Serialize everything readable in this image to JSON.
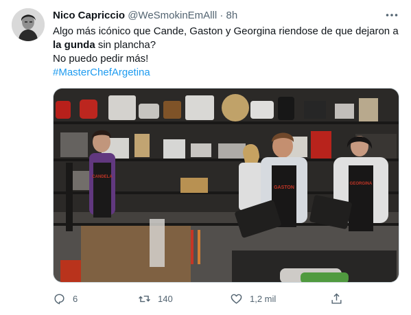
{
  "tweet": {
    "author_name": "Nico Capriccio",
    "handle": "@WeSmokinEmAlll",
    "separator": "·",
    "time": "8h",
    "text_line1": "Algo más icónico que Cande, Gaston y Georgina riendose de que dejaron a",
    "text_bold": "la gunda",
    "text_after_bold": " sin plancha?",
    "text_line3": "No puedo pedir más!",
    "hashtag": "#MasterChefArgetina",
    "media": {
      "apron_labels": [
        "CANDELA",
        "GASTON",
        "GEORGINA"
      ]
    }
  },
  "actions": {
    "reply": {
      "icon": "reply-icon",
      "count": "6"
    },
    "retweet": {
      "icon": "retweet-icon",
      "count": "140"
    },
    "like": {
      "icon": "heart-icon",
      "count": "1,2 mil"
    },
    "share": {
      "icon": "share-icon"
    }
  },
  "colors": {
    "text": "#0f1419",
    "secondary": "#536471",
    "hashtag": "#1d9bf0",
    "border": "#cfd9de"
  }
}
